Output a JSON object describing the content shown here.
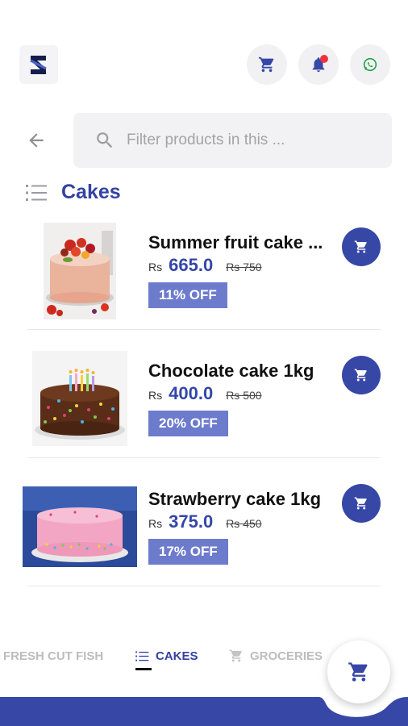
{
  "header": {
    "logo": "brand-logo",
    "actions": [
      {
        "icon": "cart-icon"
      },
      {
        "icon": "bell-icon",
        "has_notification": true
      },
      {
        "icon": "whatsapp-icon"
      }
    ]
  },
  "search": {
    "placeholder": "Filter products in this ..."
  },
  "category": {
    "title": "Cakes",
    "icon": "list-icon"
  },
  "products": [
    {
      "name": "Summer fruit cake ...",
      "currency": "Rs",
      "price": "665.0",
      "mrp": "Rs 750",
      "discount": "11% OFF"
    },
    {
      "name": "Chocolate cake 1kg",
      "currency": "Rs",
      "price": "400.0",
      "mrp": "Rs 500",
      "discount": "20% OFF"
    },
    {
      "name": "Strawberry cake 1kg",
      "currency": "Rs",
      "price": "375.0",
      "mrp": "Rs 450",
      "discount": "17% OFF"
    }
  ],
  "tabs": [
    {
      "label": "FRESH CUT FISH",
      "active": false
    },
    {
      "label": "CAKES",
      "active": true,
      "icon": "list-icon"
    },
    {
      "label": "GROCERIES",
      "active": false,
      "icon": "cart-icon"
    }
  ],
  "colors": {
    "primary": "#3747a6",
    "badge": "#6d7bcc",
    "notification": "#f0323b",
    "whatsapp": "#25a244"
  }
}
